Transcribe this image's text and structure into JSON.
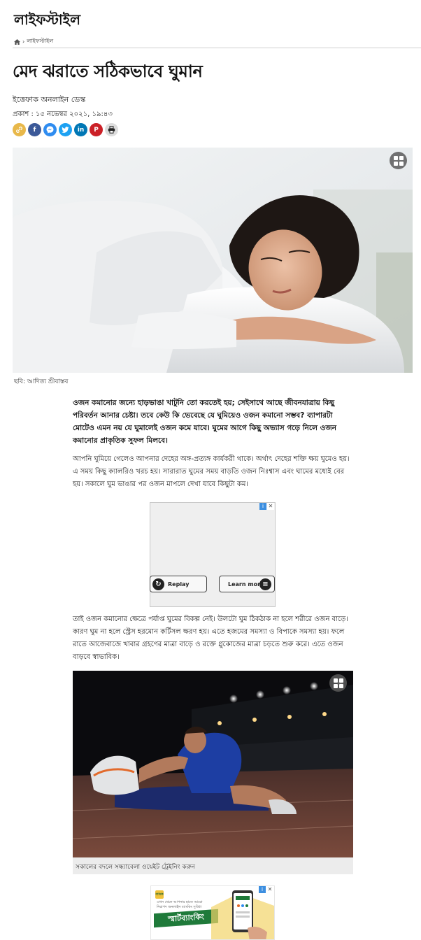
{
  "section": {
    "title": "লাইফস্টাইল"
  },
  "breadcrumb": {
    "separator": "›",
    "current": "লাইফস্টাইল"
  },
  "article": {
    "headline": "মেদ ঝরাতে সঠিকভাবে ঘুমান",
    "author": "ইত্তেফাক অনলাইন ডেস্ক",
    "published": "প্রকাশ : ১৫ নভেম্বর ২০২১, ১৯:৪৩",
    "hero_caption": "ছবি: আদিত্য শ্রীবাস্তব",
    "lead": "ওজন কমানোর জন্যে হাড়ভাঙা খাটুনি তো করতেই হয়; সেইসাথে আছে জীবনযাত্রায় কিছু পরিবর্তন আনার চেষ্টা। তবে কেউ কি ভেবেছে যে ঘুমিয়েও ওজন কমানো সম্ভব? ব্যাপারটা মোটেও এমন নয় যে ঘুমালেই ওজন কমে যাবে। ঘুমের আগে কিছু অভ্যাস গড়ে নিলে ওজন কমানোর প্রাকৃতিক সুফল মিলবে।",
    "paragraph1": "আপনি ঘুমিয়ে গেলেও আপনার দেহের অঙ্গ-প্রত্যঙ্গ কার্যকরী থাকে। অর্থাৎ দেহের শক্তি ক্ষয় ঘুমেও হয়। এ সময় কিছু ক্যালরিও খরচ হয়। সারারাত ঘুমের সময় বাড়তি ওজন নিঃশ্বাস এবং ঘামের মধ্যেই বের হয়। সকালে ঘুম ভাঙার পর ওজন মাপলে দেখা যাবে কিছুটা কম।",
    "paragraph2": "তাই ওজন কমানোর ক্ষেত্রে পর্যাপ্ত ঘুমের বিকল্প নেই। উলটো ঘুম ঠিকঠাক না হলে শরীরে ওজন বাড়ে। কারণ ঘুম না হলে স্ট্রেস হরমোন কর্টিসল ক্ষরণ হয়। এতে হজমের সমস্যা ও বিপাকে সমস্যা হয়। ফলে রাতে আজেবাজে খাবার গ্রহণের মাত্রা বাড়ে ও রক্তে গ্লুকোজের মাত্রা চড়তে শুরু করে। এতে ওজন বাড়বে স্বাভাবিক।",
    "photo2_caption": "সকালের বদলে সন্ধ্যাবেলা ওয়েইট ট্রেইনিং করুন"
  },
  "share": [
    {
      "name": "link",
      "glyph": "🔗",
      "color": "#e8b84a"
    },
    {
      "name": "facebook",
      "glyph": "f",
      "color": "#3b5998"
    },
    {
      "name": "messenger",
      "glyph": "m",
      "color": "#2f8cf0"
    },
    {
      "name": "twitter",
      "glyph": "t",
      "color": "#1da1f2"
    },
    {
      "name": "linkedin",
      "glyph": "in",
      "color": "#0077b5"
    },
    {
      "name": "pinterest",
      "glyph": "P",
      "color": "#cb2027"
    },
    {
      "name": "print",
      "glyph": "⎙",
      "color": "#dddddd"
    }
  ],
  "ad1": {
    "replay_label": "Replay",
    "learn_label": "Learn more",
    "close": "✕",
    "info": "i"
  },
  "ad2": {
    "logo": "ব্যাংক",
    "small_text": "এখন থেকে আপনার হাতে আরো নিরাপদ অনলাইন ব্যাংকিং সুবিধা",
    "brand": "স্মার্টব্যাংকিং",
    "close": "✕",
    "info": "i"
  },
  "colors": {
    "accent": "#1f7a3a",
    "rule": "#cfcfcf"
  }
}
